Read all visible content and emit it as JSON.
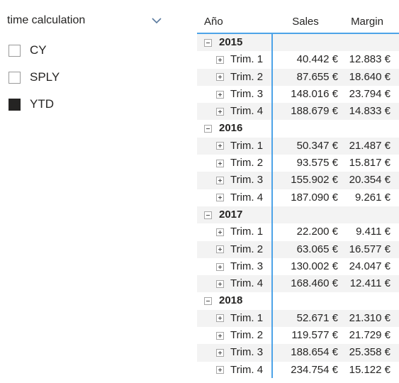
{
  "slicer": {
    "title": "time calculation",
    "chevron_icon": "chevron-down-icon",
    "items": [
      {
        "label": "CY",
        "checked": false
      },
      {
        "label": "SPLY",
        "checked": false
      },
      {
        "label": "YTD",
        "checked": true
      }
    ]
  },
  "matrix": {
    "columns": [
      "Año",
      "Sales",
      "Margin"
    ],
    "expand_icon": "plus-box-icon",
    "collapse_icon": "minus-box-icon",
    "accent_color": "#4da3e8",
    "band_color": "#f3f3f3",
    "rows": [
      {
        "level": "year",
        "label": "2015",
        "sales": "",
        "margin": "",
        "expanded": true
      },
      {
        "level": "q",
        "label": "Trim. 1",
        "sales": "40.442 €",
        "margin": "12.883 €",
        "expanded": false
      },
      {
        "level": "q",
        "label": "Trim. 2",
        "sales": "87.655 €",
        "margin": "18.640 €",
        "expanded": false
      },
      {
        "level": "q",
        "label": "Trim. 3",
        "sales": "148.016 €",
        "margin": "23.794 €",
        "expanded": false
      },
      {
        "level": "q",
        "label": "Trim. 4",
        "sales": "188.679 €",
        "margin": "14.833 €",
        "expanded": false
      },
      {
        "level": "year",
        "label": "2016",
        "sales": "",
        "margin": "",
        "expanded": true
      },
      {
        "level": "q",
        "label": "Trim. 1",
        "sales": "50.347 €",
        "margin": "21.487 €",
        "expanded": false
      },
      {
        "level": "q",
        "label": "Trim. 2",
        "sales": "93.575 €",
        "margin": "15.817 €",
        "expanded": false
      },
      {
        "level": "q",
        "label": "Trim. 3",
        "sales": "155.902 €",
        "margin": "20.354 €",
        "expanded": false
      },
      {
        "level": "q",
        "label": "Trim. 4",
        "sales": "187.090 €",
        "margin": "9.261 €",
        "expanded": false
      },
      {
        "level": "year",
        "label": "2017",
        "sales": "",
        "margin": "",
        "expanded": true
      },
      {
        "level": "q",
        "label": "Trim. 1",
        "sales": "22.200 €",
        "margin": "9.411 €",
        "expanded": false
      },
      {
        "level": "q",
        "label": "Trim. 2",
        "sales": "63.065 €",
        "margin": "16.577 €",
        "expanded": false
      },
      {
        "level": "q",
        "label": "Trim. 3",
        "sales": "130.002 €",
        "margin": "24.047 €",
        "expanded": false
      },
      {
        "level": "q",
        "label": "Trim. 4",
        "sales": "168.460 €",
        "margin": "12.411 €",
        "expanded": false
      },
      {
        "level": "year",
        "label": "2018",
        "sales": "",
        "margin": "",
        "expanded": true
      },
      {
        "level": "q",
        "label": "Trim. 1",
        "sales": "52.671 €",
        "margin": "21.310 €",
        "expanded": false
      },
      {
        "level": "q",
        "label": "Trim. 2",
        "sales": "119.577 €",
        "margin": "21.729 €",
        "expanded": false
      },
      {
        "level": "q",
        "label": "Trim. 3",
        "sales": "188.654 €",
        "margin": "25.358 €",
        "expanded": false
      },
      {
        "level": "q",
        "label": "Trim. 4",
        "sales": "234.754 €",
        "margin": "15.122 €",
        "expanded": false
      }
    ]
  }
}
